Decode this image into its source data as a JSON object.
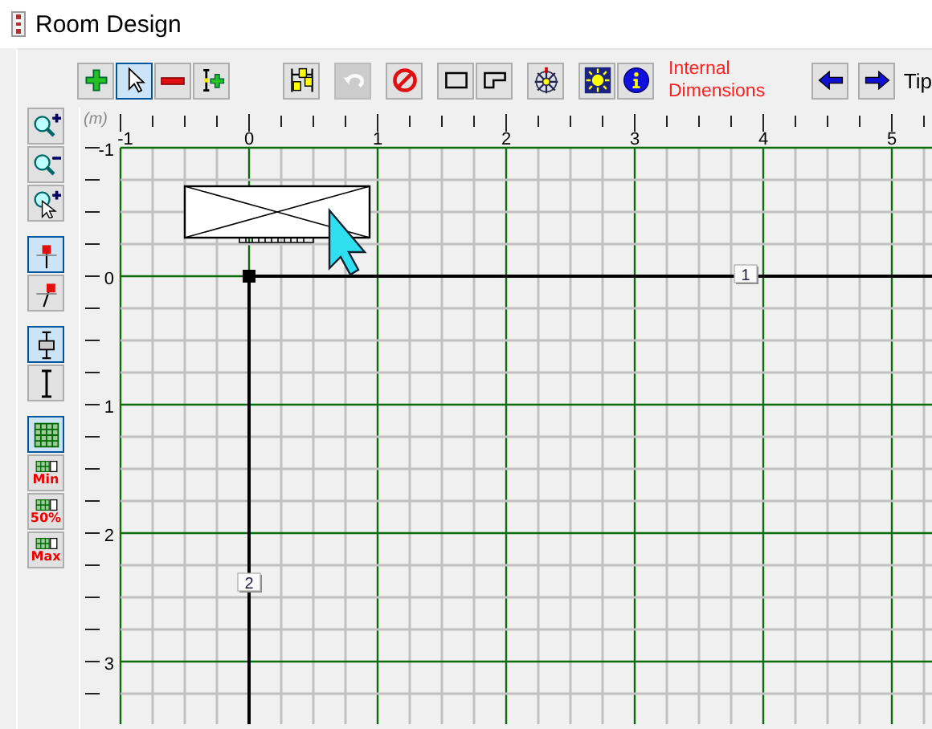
{
  "window": {
    "title": "Room Design"
  },
  "toolbar": {
    "tool_groups": [
      [
        {
          "kind": "add",
          "selected": false,
          "disabled": false
        },
        {
          "kind": "pointer",
          "selected": true,
          "disabled": false
        },
        {
          "kind": "remove",
          "selected": false,
          "disabled": false
        },
        {
          "kind": "insert",
          "selected": false,
          "disabled": false
        }
      ],
      [
        {
          "kind": "numbering",
          "selected": false,
          "disabled": false
        }
      ],
      [
        {
          "kind": "undo",
          "selected": false,
          "disabled": true
        }
      ],
      [
        {
          "kind": "cancel",
          "selected": false,
          "disabled": false
        }
      ],
      [
        {
          "kind": "rectangle",
          "selected": false,
          "disabled": false
        },
        {
          "kind": "l-shape",
          "selected": false,
          "disabled": false
        }
      ],
      [
        {
          "kind": "compass",
          "selected": false,
          "disabled": false
        }
      ],
      [
        {
          "kind": "light",
          "selected": false,
          "disabled": false
        },
        {
          "kind": "info",
          "selected": false,
          "disabled": false
        }
      ]
    ],
    "dimensions_label": "Internal Dimensions",
    "nav_buttons": [
      {
        "kind": "arrow-left",
        "selected": false,
        "disabled": false
      },
      {
        "kind": "arrow-right",
        "selected": false,
        "disabled": false
      }
    ],
    "tip_label": "Tip"
  },
  "side_groups": [
    [
      {
        "kind": "zoom-in",
        "selected": false
      },
      {
        "kind": "zoom-out",
        "selected": false
      },
      {
        "kind": "zoom-select",
        "selected": false
      }
    ],
    [
      {
        "kind": "pin",
        "selected": true
      },
      {
        "kind": "pin-angled",
        "selected": false
      }
    ],
    [
      {
        "kind": "mount",
        "selected": true
      },
      {
        "kind": "height",
        "selected": false
      }
    ],
    [
      {
        "kind": "grid",
        "selected": true
      },
      {
        "kind": "grid-label",
        "selected": false,
        "label": "Min"
      },
      {
        "kind": "grid-label",
        "selected": false,
        "label": "50%"
      },
      {
        "kind": "grid-label",
        "selected": false,
        "label": "Max"
      }
    ]
  ],
  "canvas": {
    "unit_label": "(m)",
    "x_ruler": [
      "-1",
      "0",
      "1",
      "2",
      "3",
      "4",
      "5"
    ],
    "y_ruler": [
      "-1",
      "0",
      "1",
      "2",
      "3"
    ],
    "wall_markers": [
      "1",
      "2"
    ]
  }
}
